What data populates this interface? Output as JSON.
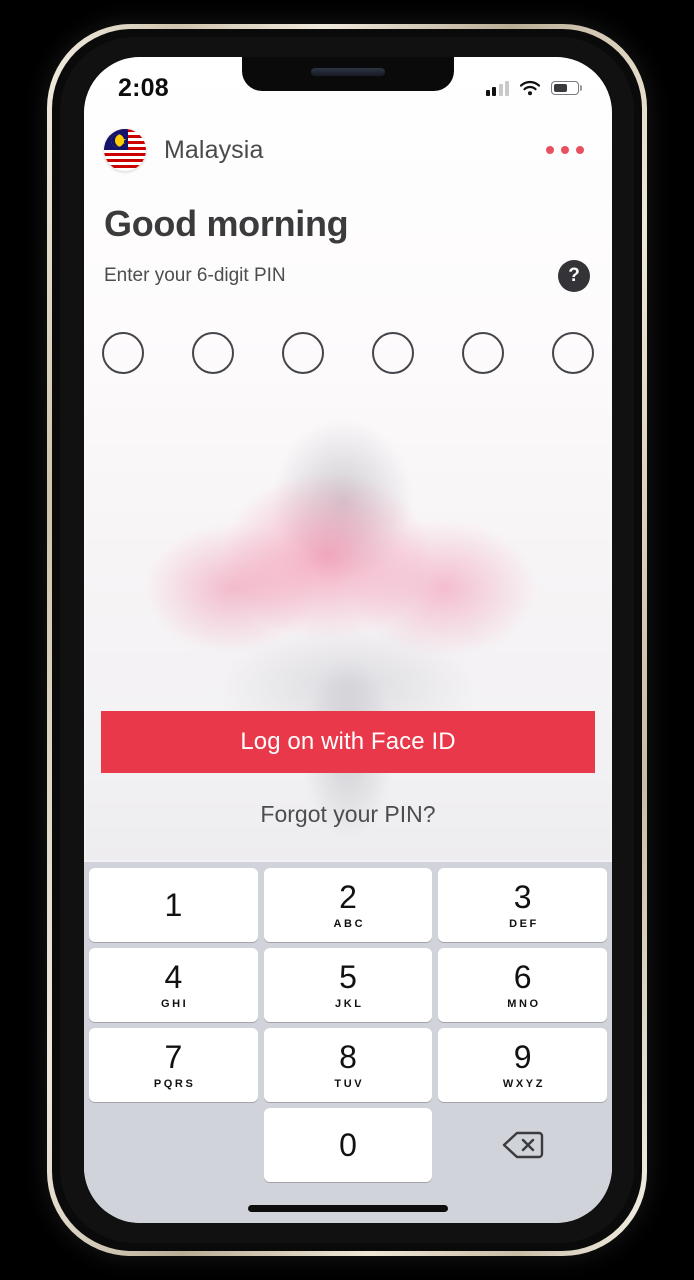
{
  "status_bar": {
    "time": "2:08",
    "signal_icon": "cellular-signal-icon",
    "wifi_icon": "wifi-icon",
    "battery_icon": "battery-icon",
    "battery_level_pct": 60
  },
  "header": {
    "flag_icon": "malaysia-flag-icon",
    "country": "Malaysia",
    "more_menu_icon": "ellipsis-menu-icon"
  },
  "main": {
    "greeting": "Good morning",
    "subtitle": "Enter your 6-digit PIN",
    "help_icon": "help-question-icon",
    "help_label": "?",
    "pin_length": 6,
    "pin_entered": 0,
    "cta_label": "Log on with Face ID",
    "forgot_label": "Forgot your PIN?"
  },
  "keypad": {
    "keys": [
      {
        "num": "1",
        "letters": ""
      },
      {
        "num": "2",
        "letters": "ABC"
      },
      {
        "num": "3",
        "letters": "DEF"
      },
      {
        "num": "4",
        "letters": "GHI"
      },
      {
        "num": "5",
        "letters": "JKL"
      },
      {
        "num": "6",
        "letters": "MNO"
      },
      {
        "num": "7",
        "letters": "PQRS"
      },
      {
        "num": "8",
        "letters": "TUV"
      },
      {
        "num": "9",
        "letters": "WXYZ"
      },
      {
        "num": "0",
        "letters": ""
      }
    ],
    "backspace_icon": "backspace-delete-icon"
  },
  "colors": {
    "accent_red": "#e8384a",
    "menu_dot_red": "#e8505f",
    "keypad_bg": "#d1d3db",
    "text_dark": "#3b3b3e"
  }
}
